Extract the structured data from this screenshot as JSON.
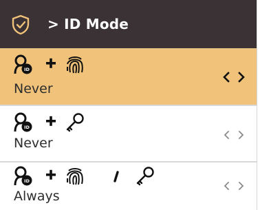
{
  "header": {
    "title": "> ID Mode",
    "icon": "shield-check-icon"
  },
  "colors": {
    "header_bg": "#3a3235",
    "selected_row_bg": "#f0c27a",
    "text": "#2d2d2d",
    "arrow_active": "#111111",
    "arrow_inactive": "#8a8a8a"
  },
  "rows": [
    {
      "combination": [
        "user-id-icon",
        "+",
        "fingerprint-icon"
      ],
      "value": "Never",
      "selected": true
    },
    {
      "combination": [
        "user-id-icon",
        "+",
        "key-icon"
      ],
      "value": "Never",
      "selected": false
    },
    {
      "combination": [
        "user-id-icon",
        "+",
        "fingerprint-icon",
        "/",
        "key-icon"
      ],
      "value": "Always",
      "selected": false
    }
  ]
}
